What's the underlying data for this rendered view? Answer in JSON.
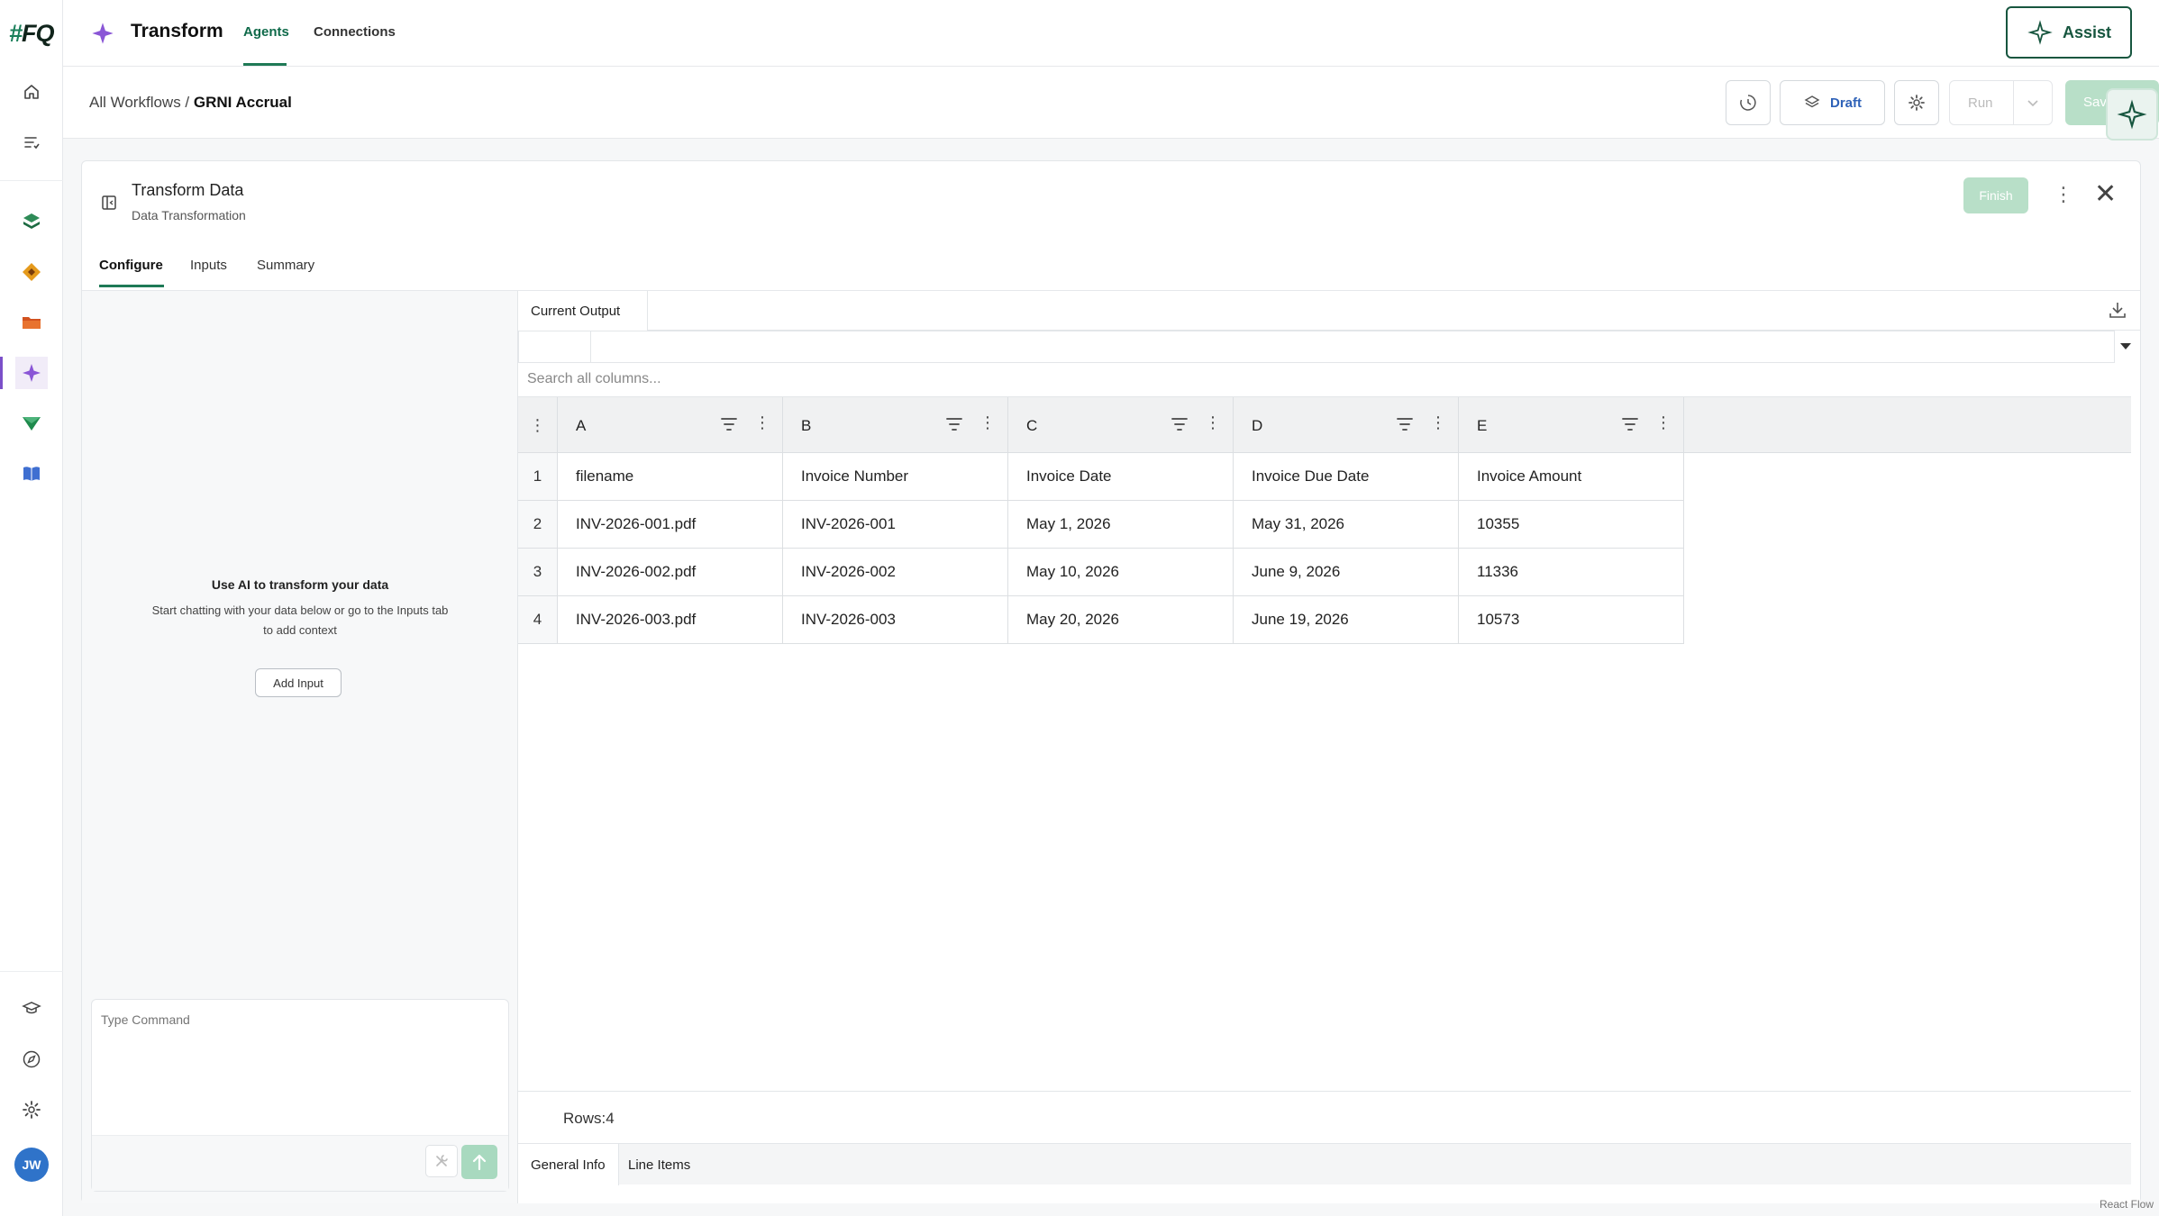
{
  "rail": {
    "logo": "FQ",
    "avatar_initials": "JW",
    "accent": "#7b4fc9"
  },
  "header": {
    "app_title": "Transform",
    "tabs": [
      {
        "label": "Agents"
      },
      {
        "label": "Connections"
      }
    ],
    "assist_label": "Assist"
  },
  "workflow": {
    "breadcrumb_parent": "All Workflows",
    "breadcrumb_separator": " / ",
    "breadcrumb_current": "GRNI Accrual",
    "draft_label": "Draft",
    "run_label": "Run",
    "save_label": "Save"
  },
  "panel": {
    "title": "Transform Data",
    "subtitle": "Data Transformation",
    "finish_label": "Finish",
    "tabs": [
      {
        "label": "Configure"
      },
      {
        "label": "Inputs"
      },
      {
        "label": "Summary"
      }
    ]
  },
  "configure": {
    "ai_title": "Use AI to transform your data",
    "ai_description": "Start chatting with your data below or go to the Inputs tab to add context",
    "add_input_label": "Add Input",
    "command_placeholder": "Type Command"
  },
  "output": {
    "tab_label": "Current Output",
    "search_placeholder": "Search all columns...",
    "columns": [
      "A",
      "B",
      "C",
      "D",
      "E"
    ],
    "rows": [
      {
        "n": "1",
        "cells": [
          "filename",
          "Invoice Number",
          "Invoice Date",
          "Invoice Due Date",
          "Invoice Amount"
        ]
      },
      {
        "n": "2",
        "cells": [
          "INV-2026-001.pdf",
          "INV-2026-001",
          "May 1, 2026",
          "May 31, 2026",
          "10355"
        ]
      },
      {
        "n": "3",
        "cells": [
          "INV-2026-002.pdf",
          "INV-2026-002",
          "May 10, 2026",
          "June 9, 2026",
          "11336"
        ]
      },
      {
        "n": "4",
        "cells": [
          "INV-2026-003.pdf",
          "INV-2026-003",
          "May 20, 2026",
          "June 19, 2026",
          "10573"
        ]
      }
    ],
    "rows_count_label": "Rows:4",
    "sheet_tabs": [
      {
        "label": "General Info"
      },
      {
        "label": "Line Items"
      }
    ]
  },
  "footer": {
    "react_flow_label": "React Flow"
  },
  "colors": {
    "brand_green": "#1f7a56",
    "disabled_green": "#b8dfc8",
    "draft_blue": "#2f62b8"
  }
}
